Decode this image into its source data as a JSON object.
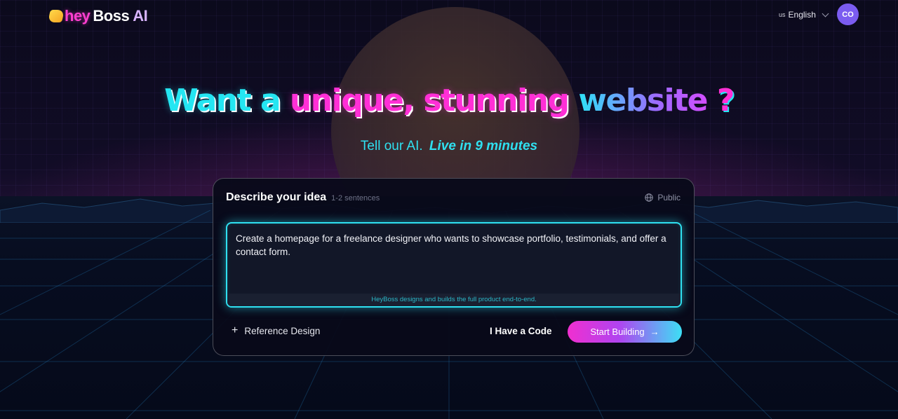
{
  "header": {
    "logo": {
      "hey": "hey",
      "boss": "Boss",
      "ai": "AI"
    },
    "language": {
      "flag": "us",
      "label": "English"
    },
    "avatar_initials": "CO"
  },
  "hero": {
    "title": {
      "part1": "Want a",
      "part2": "unique,",
      "part3": "stunning",
      "part4": "website",
      "part5": "?"
    },
    "subtitle": {
      "plain": "Tell our AI.",
      "emphasis": "Live in 9 minutes"
    }
  },
  "card": {
    "title": "Describe your idea",
    "hint": "1-2 sentences",
    "visibility": "Public",
    "prompt_text": "Create a homepage for a freelance designer who wants to showcase portfolio, testimonials, and offer a contact form.",
    "prompt_footer": "HeyBoss designs and builds the full product end-to-end.",
    "reference_label": "Reference Design",
    "code_label": "I Have a Code",
    "start_label": "Start Building"
  },
  "colors": {
    "accent_cyan": "#2fe0f0",
    "accent_pink": "#ff2fd6",
    "avatar_bg": "#7b5cf0",
    "card_bg": "#080a1a"
  },
  "icons": {
    "globe": "globe-icon",
    "plus": "plus-icon",
    "arrow": "arrow-right-icon",
    "chevron": "chevron-down-icon"
  }
}
